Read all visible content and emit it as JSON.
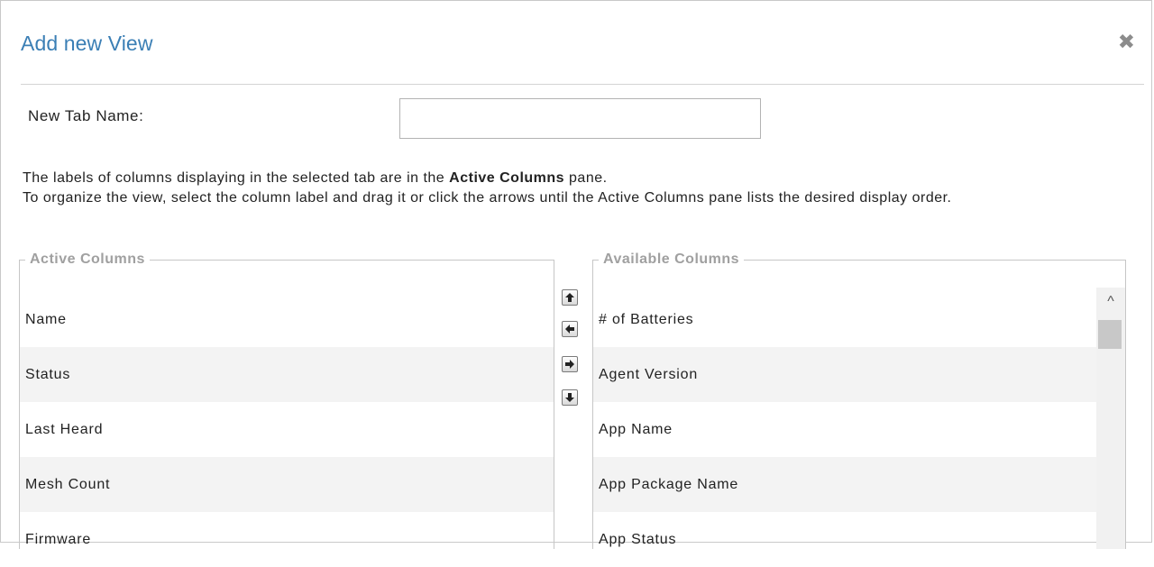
{
  "dialog": {
    "title": "Add new View",
    "close_icon": "close-icon"
  },
  "form": {
    "tab_name_label": "New Tab Name:",
    "tab_name_value": "",
    "tab_name_placeholder": ""
  },
  "instructions": {
    "line1_prefix": "The labels of columns displaying in the selected tab are in the ",
    "line1_bold": "Active Columns",
    "line1_suffix": " pane.",
    "line2": "To organize the view, select the column label and drag it or click the arrows until the Active Columns pane lists the desired display order."
  },
  "active_columns": {
    "legend": "Active Columns",
    "items": [
      "Name",
      "Status",
      "Last Heard",
      "Mesh Count",
      "Firmware"
    ]
  },
  "available_columns": {
    "legend": "Available Columns",
    "items": [
      "# of Batteries",
      "Agent Version",
      "App Name",
      "App Package Name",
      "App Status"
    ]
  },
  "arrows": {
    "up_icon": "arrow-up-icon",
    "left_icon": "arrow-left-icon",
    "right_icon": "arrow-right-icon",
    "down_icon": "arrow-down-icon"
  },
  "scrollbar": {
    "up_glyph": "^"
  },
  "colors": {
    "title": "#3b7fb5",
    "legend": "#a0a0a0",
    "row_alt": "#f3f3f3"
  }
}
